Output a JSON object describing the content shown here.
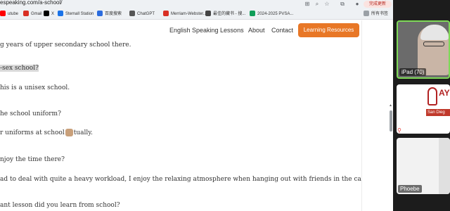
{
  "browser": {
    "url": "espeaking.com/a-school/",
    "update_label": "完成更新",
    "bookmarks": [
      {
        "label": "utube",
        "color": "#ff0000"
      },
      {
        "label": "Gmail",
        "color": "#d93025"
      },
      {
        "label": "X",
        "color": "#000000"
      },
      {
        "label": "Stemall Station",
        "color": "#1a73e8"
      },
      {
        "label": "百度搜索",
        "color": "#2b6cde"
      },
      {
        "label": "ChatGPT",
        "color": "#555555"
      },
      {
        "label": "Merriam-Webster...",
        "color": "#d93025"
      },
      {
        "label": "最佳的藏书 - 搜...",
        "color": "#444444"
      },
      {
        "label": "2024-2025 PVSA...",
        "color": "#0f9d58"
      }
    ],
    "all_bookmarks": "所有书签"
  },
  "nav": {
    "links": [
      "English Speaking Lessons",
      "About",
      "Contact"
    ],
    "cta": "Learning Resources"
  },
  "content": {
    "line1": "g years of upper secondary school there.",
    "line2": "-sex school?",
    "line3": "his is a unisex school.",
    "line4": "he school uniform?",
    "line5_a": "r uniforms at school",
    "line5_b": "tually.",
    "line6": "njoy the time there?",
    "line7": "ad to deal with quite a heavy workload, I enjoy the relaxing atmosphere when hanging out with friends in the cafeteria there.",
    "line8": "ant lesson did you learn from school?"
  },
  "video": {
    "tile1_label": "iPad (70)",
    "tile2_label": "AYLUS San Di",
    "tile2_logo": "AYL",
    "tile2_bar": "San Dieg",
    "tile3_label": "Phoebe"
  }
}
